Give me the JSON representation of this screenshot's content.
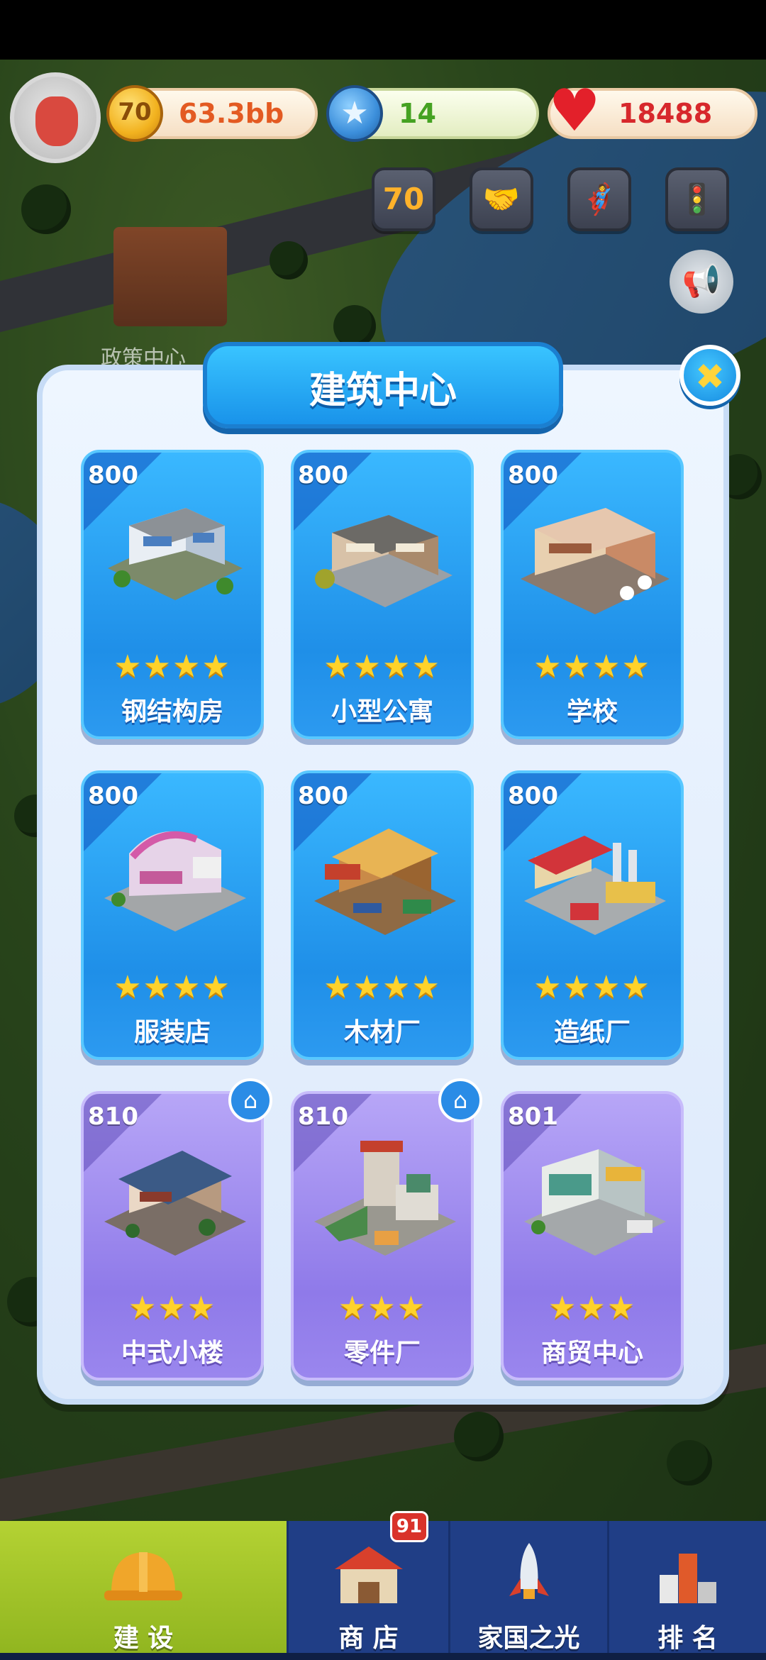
{
  "hud": {
    "coins": "63.3bb",
    "coin_icon_text": "70",
    "gems": "14",
    "gem_icon": "star-gem-icon",
    "hearts": "18488",
    "heart_icon": "heart-icon",
    "event_buttons": [
      {
        "icon": "anniversary-70-icon",
        "glyph": "70"
      },
      {
        "icon": "handshake-icon",
        "glyph": "🤝"
      },
      {
        "icon": "character-icon",
        "glyph": "🦸"
      },
      {
        "icon": "traffic-light-icon",
        "glyph": "🚦"
      }
    ],
    "megaphone_icon": "megaphone-icon"
  },
  "map": {
    "label": "政策中心"
  },
  "modal": {
    "title": "建筑中心",
    "close_icon": "close-icon",
    "close_glyph": "✖",
    "buildings": [
      {
        "level": "800",
        "name": "钢结构房",
        "stars": "★★★★",
        "star_count": 4,
        "has_home_badge": false
      },
      {
        "level": "800",
        "name": "小型公寓",
        "stars": "★★★★",
        "star_count": 4,
        "has_home_badge": false
      },
      {
        "level": "800",
        "name": "学校",
        "stars": "★★★★",
        "star_count": 4,
        "has_home_badge": false
      },
      {
        "level": "800",
        "name": "服装店",
        "stars": "★★★★",
        "star_count": 4,
        "has_home_badge": false
      },
      {
        "level": "800",
        "name": "木材厂",
        "stars": "★★★★",
        "star_count": 4,
        "has_home_badge": false
      },
      {
        "level": "800",
        "name": "造纸厂",
        "stars": "★★★★",
        "star_count": 4,
        "has_home_badge": false
      },
      {
        "level": "810",
        "name": "中式小楼",
        "stars": "★★★",
        "star_count": 3,
        "has_home_badge": true
      },
      {
        "level": "810",
        "name": "零件厂",
        "stars": "★★★",
        "star_count": 3,
        "has_home_badge": true
      },
      {
        "level": "801",
        "name": "商贸中心",
        "stars": "★★★",
        "star_count": 3,
        "has_home_badge": false
      }
    ],
    "home_glyph": "⌂"
  },
  "tabs": [
    {
      "label": "建 设",
      "icon": "hard-hat-icon",
      "active": true
    },
    {
      "label": "商 店",
      "icon": "shop-icon",
      "active": false,
      "badge": "91"
    },
    {
      "label": "家国之光",
      "icon": "rocket-icon",
      "active": false
    },
    {
      "label": "排 名",
      "icon": "ranking-icon",
      "active": false
    }
  ],
  "colors": {
    "card_blue": "#1f8fe8",
    "card_purple": "#8f7ae9",
    "title_bar": "#1993ea",
    "tab_active": "#a6c62b",
    "tab_bar": "#203e86",
    "star": "#ffd22a"
  }
}
